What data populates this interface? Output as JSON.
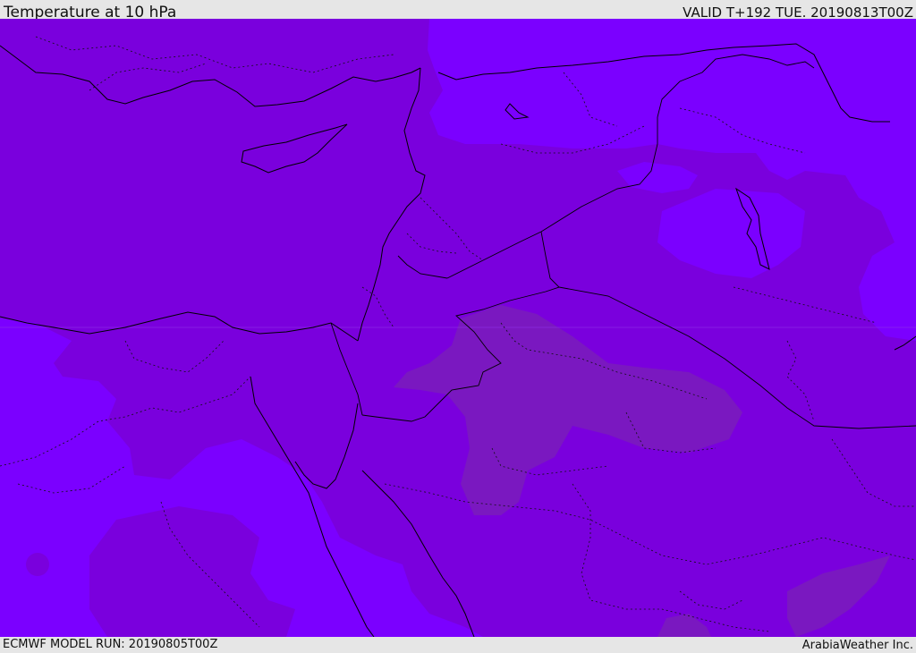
{
  "header": {
    "title": "Temperature at 10 hPa",
    "valid": "VALID T+192 TUE. 20190813T00Z"
  },
  "footer": {
    "model_run": "ECMWF MODEL RUN: 20190805T00Z",
    "credit": "ArabiaWeather Inc."
  },
  "colors": {
    "field_mid": "#7a00dd",
    "field_cool": "#7b00ff",
    "field_warm": "#7a18c0",
    "coastline": "#000000",
    "bar_background": "#e6e6e6"
  },
  "map": {
    "level": "10 hPa",
    "field": "Temperature"
  }
}
